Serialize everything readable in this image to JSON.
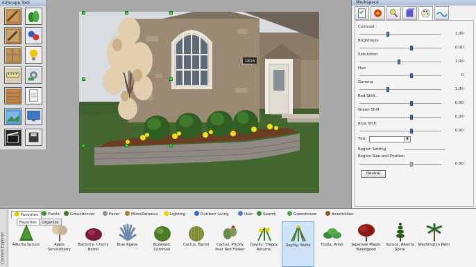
{
  "toolbox": {
    "title": "EZScape Tool",
    "tools": [
      {
        "icon": "paint-roller-icon"
      },
      {
        "icon": "plant-cluster-icon"
      },
      {
        "icon": "brush-icon"
      },
      {
        "icon": "color-swap-icon"
      },
      {
        "icon": "paver-path-icon"
      },
      {
        "icon": "lightbulb-icon"
      },
      {
        "icon": "measure-tool-icon"
      },
      {
        "icon": "gear-tools-icon"
      },
      {
        "icon": "wood-texture-icon"
      },
      {
        "icon": "document-icon"
      },
      {
        "icon": "image-crop-icon"
      },
      {
        "icon": "monitor-icon"
      },
      {
        "icon": "clapperboard-icon"
      },
      {
        "icon": "save-disk-icon"
      }
    ]
  },
  "scene": {
    "house_number": "1816"
  },
  "workspace": {
    "title": "Workspace",
    "tabs": [
      {
        "icon": "checklist-icon"
      },
      {
        "icon": "flower-badge-icon"
      },
      {
        "icon": "magnify-plant-icon"
      },
      {
        "icon": "cube-icon"
      },
      {
        "icon": "color-palette-icon"
      },
      {
        "icon": "wave-icon"
      }
    ],
    "adjustments": [
      {
        "label": "Contrast",
        "value": "1.00",
        "level": 0.33
      },
      {
        "label": "Brightness",
        "value": "0.00",
        "level": 0.62
      },
      {
        "label": "Saturation",
        "value": "1.00",
        "level": 0.47
      },
      {
        "label": "Hue",
        "value": "0",
        "level": 0.62
      },
      {
        "label": "Gamma",
        "value": "1.00",
        "level": 0.33
      },
      {
        "label": "Red Shift",
        "value": "0.00",
        "level": 0.62
      },
      {
        "label": "Green Shift",
        "value": "0.00",
        "level": 0.62
      },
      {
        "label": "Blue Shift",
        "value": "0.00",
        "level": 0.62
      }
    ],
    "tint_label": "Tint:",
    "region_setting_label": "Region Setting",
    "region_size_label": "Region Size and Position",
    "region_size_value": "0.00",
    "neutral_label": "Neutral"
  },
  "explorer": {
    "side_label": "Content Explorer",
    "categories": [
      {
        "label": "Favorites",
        "color": "#e7c400",
        "active": true
      },
      {
        "label": "Plants",
        "color": "#3c9a2c"
      },
      {
        "label": "Groundcover",
        "color": "#3c7a1c"
      },
      {
        "label": "Paver",
        "color": "#8e8e8e"
      },
      {
        "label": "Miscellaneous",
        "color": "#b07a2c"
      },
      {
        "label": "Lighting",
        "color": "#f0d000"
      },
      {
        "label": "Outdoor Living",
        "color": "#2c6ac0"
      },
      {
        "label": "User",
        "color": "#4a7ad0"
      },
      {
        "label": "Search",
        "color": "#3a8a3a"
      },
      {
        "label": "Greenhouse",
        "color": "#4aaa4a"
      },
      {
        "label": "Assemblies",
        "color": "#8a5a2a"
      }
    ],
    "subtabs": [
      {
        "label": "Favorites",
        "active": true
      },
      {
        "label": "Organize"
      }
    ],
    "plants": [
      {
        "name": "Alberta Spruce",
        "kind": "spruce"
      },
      {
        "name": "Apple Serviceberry",
        "kind": "shrub-pale"
      },
      {
        "name": "Barberry, Cherry Bomb",
        "kind": "barberry"
      },
      {
        "name": "Blue Agave",
        "kind": "agave"
      },
      {
        "name": "Boxwood, Common",
        "kind": "boxwood"
      },
      {
        "name": "Cactus, Barrel",
        "kind": "barrel"
      },
      {
        "name": "Cactus, Prickly Pear Red Flower",
        "kind": "prickly"
      },
      {
        "name": "Daylily, 'Happy Returns'",
        "kind": "daylily"
      },
      {
        "name": "Daylily, Stella",
        "kind": "stella",
        "selected": true
      },
      {
        "name": "Hosta, Amel",
        "kind": "hosta"
      },
      {
        "name": "Japanese Maple Bloodgood",
        "kind": "maple"
      },
      {
        "name": "Spruce, Alberta Spiral",
        "kind": "spiral"
      },
      {
        "name": "Washington Palm",
        "kind": "palm"
      }
    ]
  }
}
